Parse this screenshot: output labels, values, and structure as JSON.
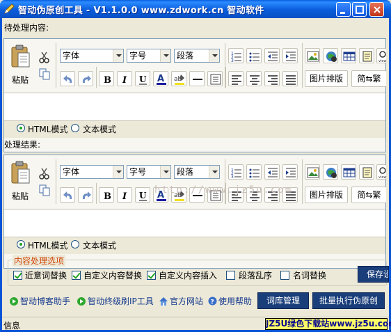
{
  "window": {
    "title": "智动伪原创工具 - V1.1.0.0 www.zdwork.cn 智动软件"
  },
  "input_section": {
    "label": "待处理内容:",
    "editor": {
      "paste_label": "粘贴",
      "font_combo": "字体",
      "size_combo": "字号",
      "para_combo": "段落",
      "image_layout_button": "图片排版",
      "convert_button": "简⇆繁",
      "mode_html": "HTML模式",
      "mode_text": "文本模式",
      "selected_mode": "HTML模式"
    }
  },
  "output_section": {
    "label": "处理结果:",
    "editor": {
      "paste_label": "粘贴",
      "font_combo": "字体",
      "size_combo": "字号",
      "para_combo": "段落",
      "image_layout_button": "图片排版",
      "convert_button": "简⇆繁",
      "mode_html": "HTML模式",
      "mode_text": "文本模式",
      "selected_mode": "HTML模式"
    },
    "watermark": "http://www.jz5u.com"
  },
  "options": {
    "title": "内容处理选项",
    "checkboxes": [
      {
        "label": "近意词替换",
        "checked": true
      },
      {
        "label": "自定义内容替换",
        "checked": true
      },
      {
        "label": "自定义内容插入",
        "checked": true
      },
      {
        "label": "段落乱序",
        "checked": false
      },
      {
        "label": "名词替换",
        "checked": false
      }
    ],
    "save_button": "保存设"
  },
  "links": {
    "blog": "智动博客助手",
    "ip": "智动终级刷IP工具",
    "site": "官方网站",
    "help": "使用帮助"
  },
  "actions": {
    "dict_button": "词库管理",
    "batch_button": "批量执行伪原创"
  },
  "status": {
    "info": "信息",
    "banner": "JZ5U绿色下载站www.jz5u.com"
  },
  "colors": {
    "titlebar": "#0A5CDB",
    "accent_button": "#1A3E7A",
    "group_title": "#D2470A",
    "banner_bg": "#FFFF66"
  }
}
